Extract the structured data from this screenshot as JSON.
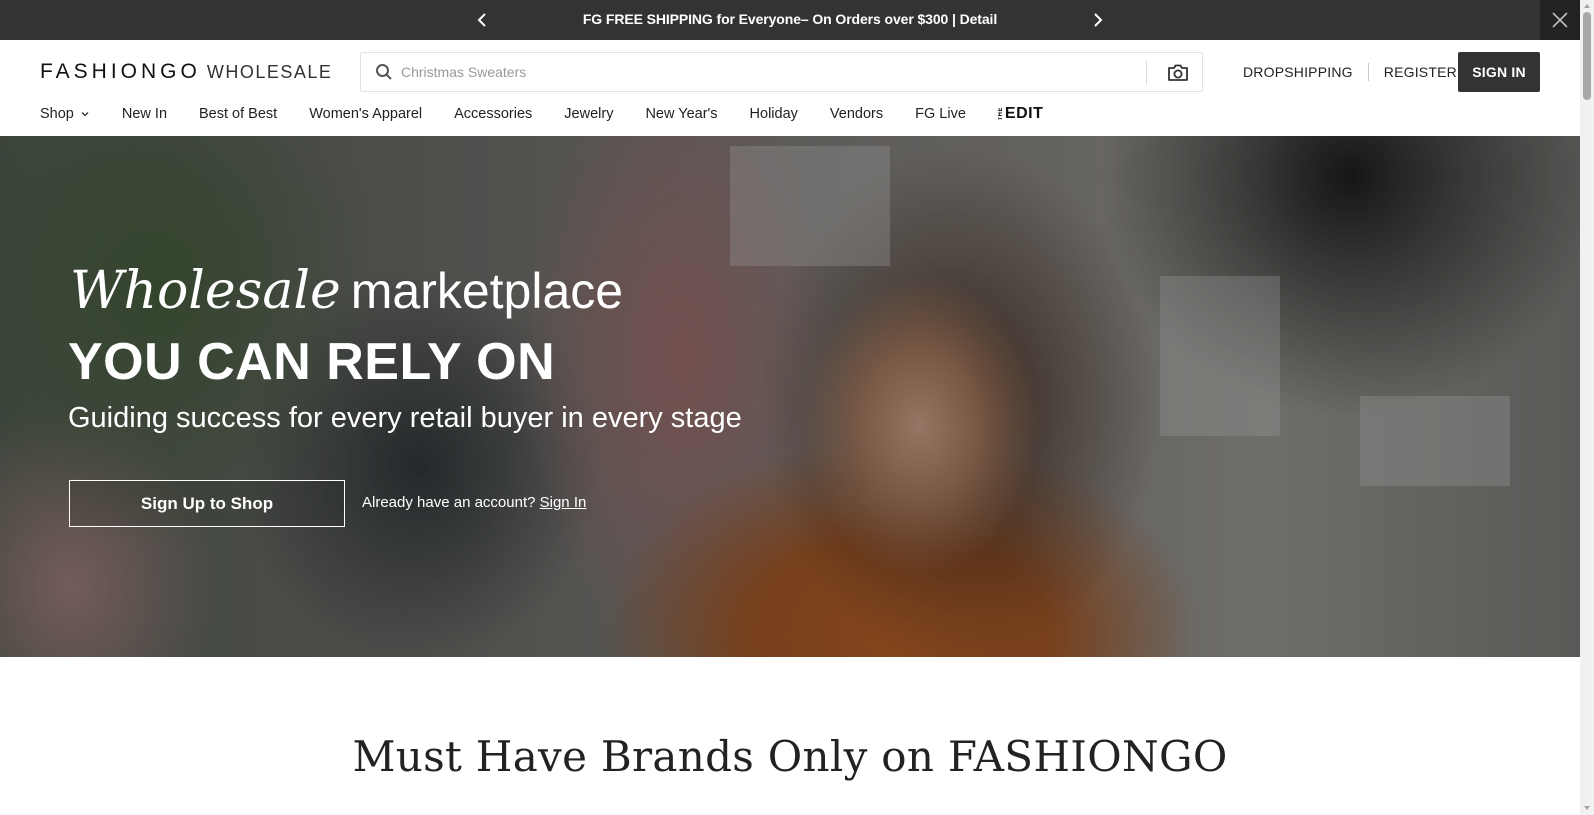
{
  "promo": {
    "text": "FG FREE SHIPPING for Everyone– On Orders over $300 | Detail",
    "prev_icon": "chevron-left",
    "next_icon": "chevron-right",
    "close_icon": "close"
  },
  "header": {
    "logo_main": "FASHIONGO",
    "logo_sub": "WHOLESALE",
    "search": {
      "placeholder": "Christmas Sweaters",
      "value": ""
    },
    "links": {
      "dropshipping": "DROPSHIPPING",
      "register": "REGISTER",
      "sign_in": "SIGN IN"
    }
  },
  "nav": {
    "items": [
      "Shop",
      "New In",
      "Best of Best",
      "Women's Apparel",
      "Accessories",
      "Jewelry",
      "New Year's",
      "Holiday",
      "Vendors",
      "FG Live"
    ],
    "edit_the": "THE",
    "edit_label": "EDIT"
  },
  "hero": {
    "line1_italic": "Wholesale",
    "line1_rest": "marketplace",
    "line2": "YOU CAN RELY ON",
    "line3": "Guiding success for every retail buyer in every stage",
    "cta_label": "Sign Up to Shop",
    "account_prompt": "Already have an account?",
    "account_link": "Sign In"
  },
  "section": {
    "title": "Must Have Brands Only on FASHIONGO"
  },
  "colors": {
    "promo_bg": "#333333",
    "sign_in_bg": "#333333",
    "text_dark": "#222222"
  }
}
